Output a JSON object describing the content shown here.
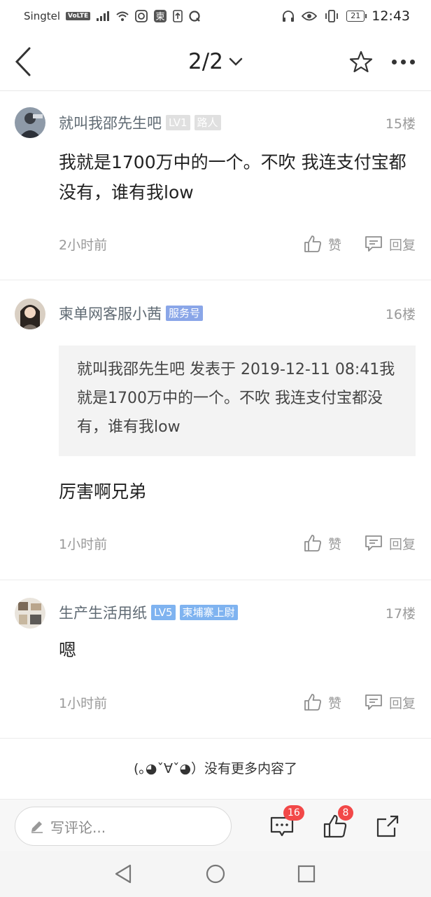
{
  "status": {
    "carrier": "Singtel",
    "volte": "VoLTE",
    "battery": "21",
    "time": "12:43"
  },
  "header": {
    "page": "2/2"
  },
  "comments": [
    {
      "username": "就叫我邵先生吧",
      "tags": [
        "LV1",
        "路人"
      ],
      "floor": "15楼",
      "text": "我就是1700万中的一个。不吹 我连支付宝都没有，谁有我low",
      "time": "2小时前",
      "like_label": "赞",
      "reply_label": "回复"
    },
    {
      "username": "柬单网客服小茜",
      "tags": [
        "服务号"
      ],
      "floor": "16楼",
      "quote": "就叫我邵先生吧 发表于 2019-12-11 08:41我就是1700万中的一个。不吹 我连支付宝都没有，谁有我low",
      "text": "厉害啊兄弟",
      "time": "1小时前",
      "like_label": "赞",
      "reply_label": "回复"
    },
    {
      "username": "生产生活用纸",
      "tags": [
        "LV5",
        "柬埔寨上尉"
      ],
      "floor": "17楼",
      "text": "嗯",
      "time": "1小时前",
      "like_label": "赞",
      "reply_label": "回复"
    }
  ],
  "end_note": "(｡◕ˇ∀ˇ◕）没有更多内容了",
  "bottom_bar": {
    "placeholder": "写评论...",
    "comment_count": "16",
    "like_count": "8"
  },
  "colors": {
    "badge_red": "#f24848",
    "tag_gray": "#e0e0e0",
    "tag_blue": "#8aa6e8",
    "tag_lightblue": "#7fb3f0"
  }
}
